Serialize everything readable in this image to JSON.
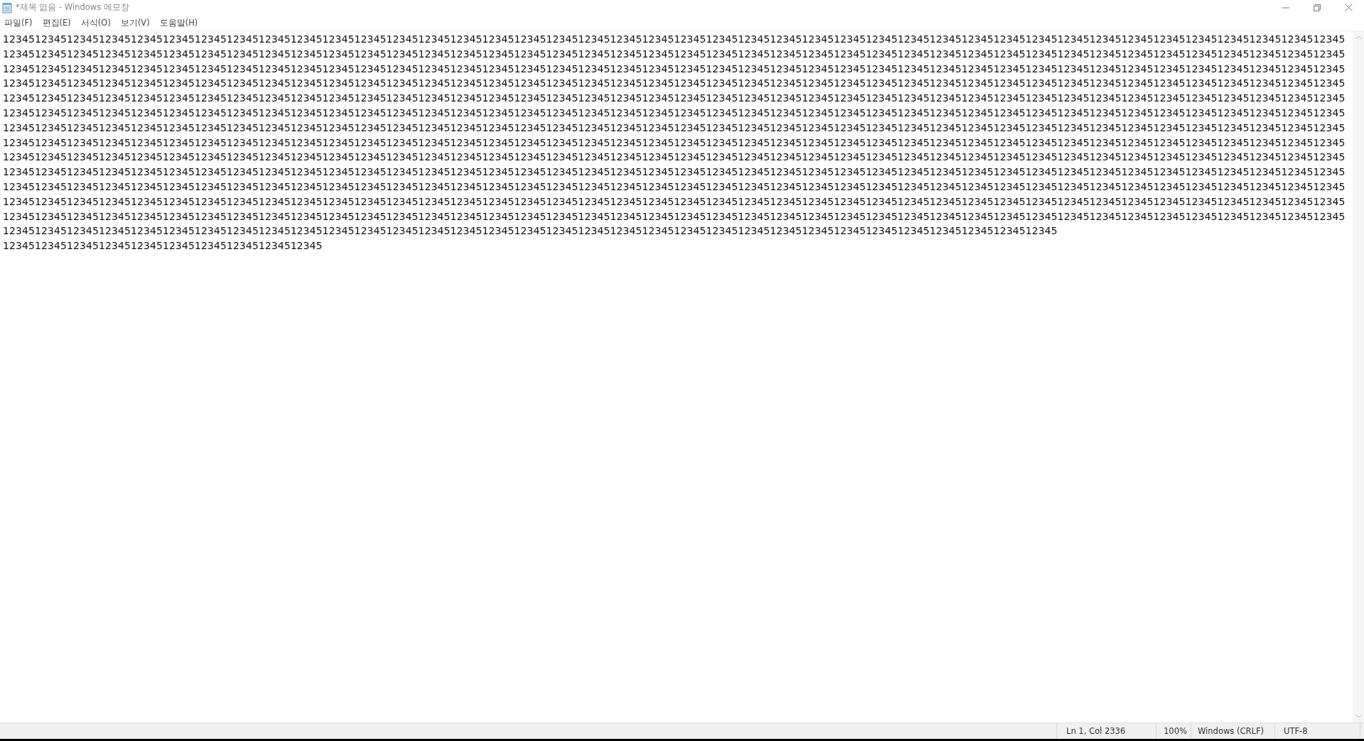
{
  "window": {
    "title": "*제목 없음 - Windows 메모장"
  },
  "menu": [
    "파일(F)",
    "편집(E)",
    "서식(O)",
    "보기(V)",
    "도움말(H)"
  ],
  "editor": {
    "lines": [
      "123451234512345123451234512345123451234512345123451234512345123451234512345123451234512345123451234512345123451234512345123451234512345123451234512345123451234512345123451234512345123451234512345123451234512345",
      "123451234512345123451234512345123451234512345123451234512345123451234512345123451234512345123451234512345123451234512345123451234512345123451234512345123451234512345123451234512345123451234512345123451234512345",
      "123451234512345123451234512345123451234512345123451234512345123451234512345123451234512345123451234512345123451234512345123451234512345123451234512345123451234512345123451234512345123451234512345123451234512345",
      "123451234512345123451234512345123451234512345123451234512345123451234512345123451234512345123451234512345123451234512345123451234512345123451234512345123451234512345123451234512345123451234512345123451234512345",
      "123451234512345123451234512345123451234512345123451234512345123451234512345123451234512345123451234512345123451234512345123451234512345123451234512345123451234512345123451234512345123451234512345123451234512345",
      "123451234512345123451234512345123451234512345123451234512345123451234512345123451234512345123451234512345123451234512345123451234512345123451234512345123451234512345123451234512345123451234512345123451234512345",
      "123451234512345123451234512345123451234512345123451234512345123451234512345123451234512345123451234512345123451234512345123451234512345123451234512345123451234512345123451234512345123451234512345123451234512345",
      "123451234512345123451234512345123451234512345123451234512345123451234512345123451234512345123451234512345123451234512345123451234512345123451234512345123451234512345123451234512345123451234512345123451234512345",
      "123451234512345123451234512345123451234512345123451234512345123451234512345123451234512345123451234512345123451234512345123451234512345123451234512345123451234512345123451234512345123451234512345123451234512345",
      "123451234512345123451234512345123451234512345123451234512345123451234512345123451234512345123451234512345123451234512345123451234512345123451234512345123451234512345123451234512345123451234512345123451234512345",
      "123451234512345123451234512345123451234512345123451234512345123451234512345123451234512345123451234512345123451234512345123451234512345123451234512345123451234512345123451234512345123451234512345123451234512345",
      "123451234512345123451234512345123451234512345123451234512345123451234512345123451234512345123451234512345123451234512345123451234512345123451234512345123451234512345123451234512345123451234512345123451234512345",
      "123451234512345123451234512345123451234512345123451234512345123451234512345123451234512345123451234512345123451234512345123451234512345123451234512345123451234512345123451234512345123451234512345123451234512345",
      "123451234512345123451234512345123451234512345123451234512345123451234512345123451234512345123451234512345123451234512345123451234512345123451234512345123451234512345",
      "12345123451234512345123451234512345123451234512345"
    ]
  },
  "status_bar": [
    "Ln 1, Col 2336",
    "100%",
    "Windows (CRLF)",
    "UTF-8"
  ]
}
